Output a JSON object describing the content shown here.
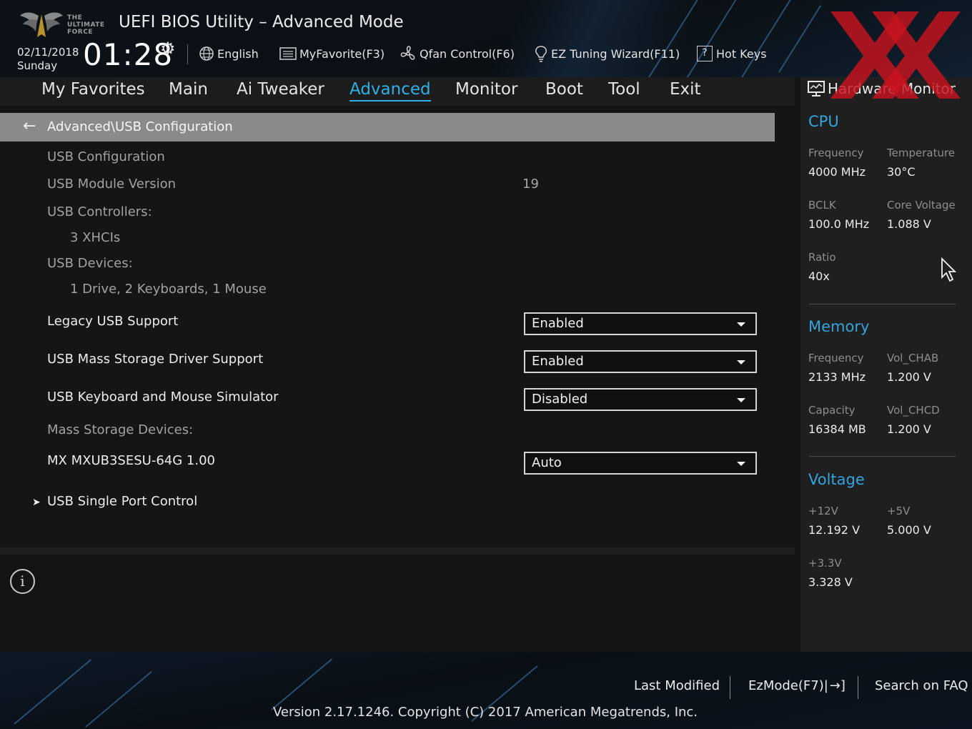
{
  "header": {
    "brand_text": "THE\nULTIMATE\nFORCE",
    "title": "UEFI BIOS Utility – Advanced Mode",
    "date": "02/11/2018",
    "day": "Sunday",
    "time": "01:28",
    "items": [
      {
        "label": "English",
        "icon": "globe-icon"
      },
      {
        "label": "MyFavorite(F3)",
        "icon": "favorite-list-icon"
      },
      {
        "label": "Qfan Control(F6)",
        "icon": "fan-icon"
      },
      {
        "label": "EZ Tuning Wizard(F11)",
        "icon": "lightbulb-icon"
      },
      {
        "label": "Hot Keys",
        "icon": "help-box-icon"
      }
    ]
  },
  "tabs": [
    {
      "label": "My Favorites"
    },
    {
      "label": "Main"
    },
    {
      "label": "Ai Tweaker"
    },
    {
      "label": "Advanced",
      "active": true
    },
    {
      "label": "Monitor"
    },
    {
      "label": "Boot"
    },
    {
      "label": "Tool"
    },
    {
      "label": "Exit"
    }
  ],
  "main": {
    "breadcrumb": "Advanced\\USB Configuration",
    "usb_configuration": "USB Configuration",
    "module_version_label": "USB Module Version",
    "module_version_value": "19",
    "controllers_label": "USB Controllers:",
    "controllers_value": "3 XHCIs",
    "devices_label": "USB Devices:",
    "devices_value": "1 Drive, 2 Keyboards, 1 Mouse",
    "legacy_label": "Legacy USB Support",
    "legacy_value": "Enabled",
    "mass_storage_label": "USB Mass Storage Driver Support",
    "mass_storage_value": "Enabled",
    "kbd_sim_label": "USB Keyboard and Mouse Simulator",
    "kbd_sim_value": "Disabled",
    "mass_devices_label": "Mass Storage Devices:",
    "device_label": "MX MXUB3SESU-64G 1.00",
    "device_value": "Auto",
    "single_port_label": "USB Single Port Control"
  },
  "hw_monitor": {
    "title": "Hardware Monitor",
    "cpu": {
      "title": "CPU",
      "frequency_label": "Frequency",
      "frequency": "4000 MHz",
      "temperature_label": "Temperature",
      "temperature": "30°C",
      "bclk_label": "BCLK",
      "bclk": "100.0 MHz",
      "core_voltage_label": "Core Voltage",
      "core_voltage": "1.088 V",
      "ratio_label": "Ratio",
      "ratio": "40x"
    },
    "memory": {
      "title": "Memory",
      "frequency_label": "Frequency",
      "frequency": "2133 MHz",
      "vol_chab_label": "Vol_CHAB",
      "vol_chab": "1.200 V",
      "capacity_label": "Capacity",
      "capacity": "16384 MB",
      "vol_chcd_label": "Vol_CHCD",
      "vol_chcd": "1.200 V"
    },
    "voltage": {
      "title": "Voltage",
      "v12_label": "+12V",
      "v12": "12.192 V",
      "v5_label": "+5V",
      "v5": "5.000 V",
      "v33_label": "+3.3V",
      "v33": "3.328 V"
    }
  },
  "footer": {
    "last_modified": "Last Modified",
    "ezmode": "EzMode(F7)|",
    "search_faq": "Search on FAQ",
    "version": "Version 2.17.1246. Copyright (C) 2017 American Megatrends, Inc."
  },
  "colors": {
    "accent": "#2fb0e6",
    "section_title": "#33a4dc",
    "breadcrumb_bg": "#8a8a8a",
    "watermark": "#c8141e"
  }
}
